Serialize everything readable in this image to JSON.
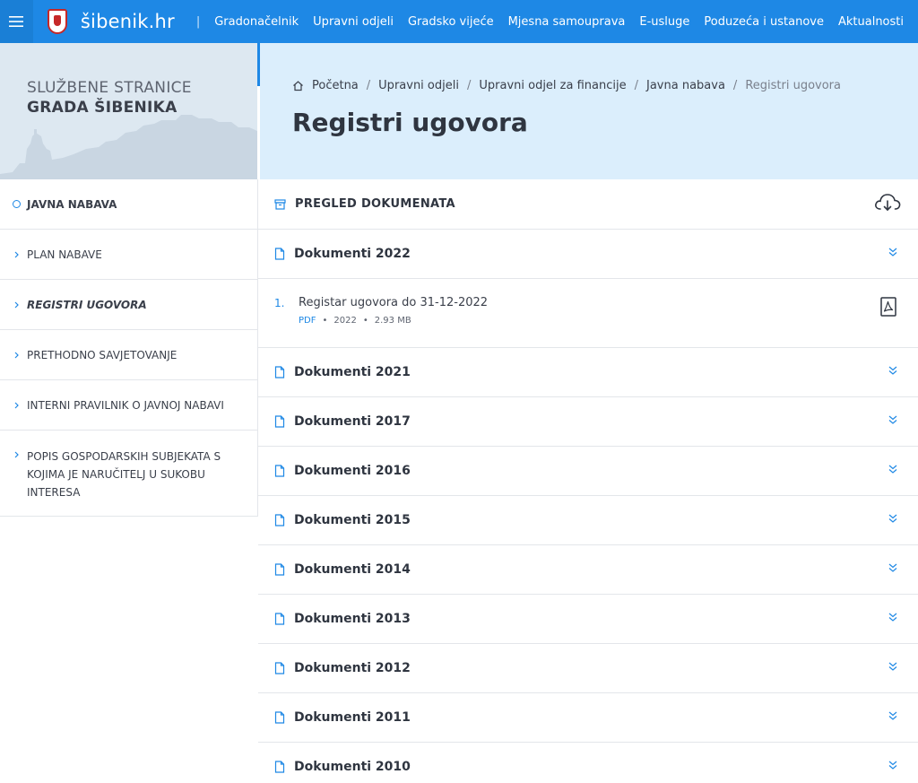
{
  "header": {
    "brand": "šibenik.hr",
    "separator": "|",
    "nav": [
      "Gradonačelnik",
      "Upravni odjeli",
      "Gradsko vijeće",
      "Mjesna samouprava",
      "E-usluge",
      "Poduzeća i ustanove",
      "Aktualnosti"
    ]
  },
  "site": {
    "title_line1": "SLUŽBENE STRANICE",
    "title_line2": "GRADA ŠIBENIKA"
  },
  "breadcrumb": {
    "home": "Početna",
    "items": [
      "Upravni odjeli",
      "Upravni odjel za financije",
      "Javna nabava"
    ],
    "current": "Registri ugovora",
    "separator": "/"
  },
  "page": {
    "title": "Registri ugovora"
  },
  "sidebar": {
    "items": [
      {
        "label": "JAVNA NABAVA"
      },
      {
        "label": "PLAN NABAVE"
      },
      {
        "label": "REGISTRI UGOVORA"
      },
      {
        "label": "PRETHODNO SAVJETOVANJE"
      },
      {
        "label": "INTERNI PRAVILNIK O JAVNOJ NABAVI"
      },
      {
        "label": "POPIS GOSPODARSKIH SUBJEKATA S KOJIMA JE NARUČITELJ U SUKOBU INTERESA"
      }
    ]
  },
  "main": {
    "header_title": "PREGLED DOKUMENATA",
    "sections": [
      {
        "title": "Dokumenti 2022"
      },
      {
        "title": "Dokumenti 2021"
      },
      {
        "title": "Dokumenti 2017"
      },
      {
        "title": "Dokumenti 2016"
      },
      {
        "title": "Dokumenti 2015"
      },
      {
        "title": "Dokumenti 2014"
      },
      {
        "title": "Dokumenti 2013"
      },
      {
        "title": "Dokumenti 2012"
      },
      {
        "title": "Dokumenti 2011"
      },
      {
        "title": "Dokumenti 2010"
      }
    ],
    "documents": [
      {
        "number": "1.",
        "title": "Registar ugovora do 31-12-2022",
        "type": "PDF",
        "year": "2022",
        "size": "2.93 MB",
        "meta_separator": "•"
      }
    ]
  },
  "icons": {
    "menu": "hamburger-menu-icon",
    "crest": "city-crest-icon",
    "home": "home-icon",
    "archive": "archive-box-icon",
    "download": "cloud-download-icon",
    "document": "document-icon",
    "chevron": "double-chevron-down-icon",
    "pdf": "pdf-file-icon"
  },
  "colors": {
    "primary": "#1e88e5",
    "hero_bg": "#dbeefc",
    "sidebar_hero_bg": "#dde8f1",
    "text_dark": "#2f3540"
  }
}
